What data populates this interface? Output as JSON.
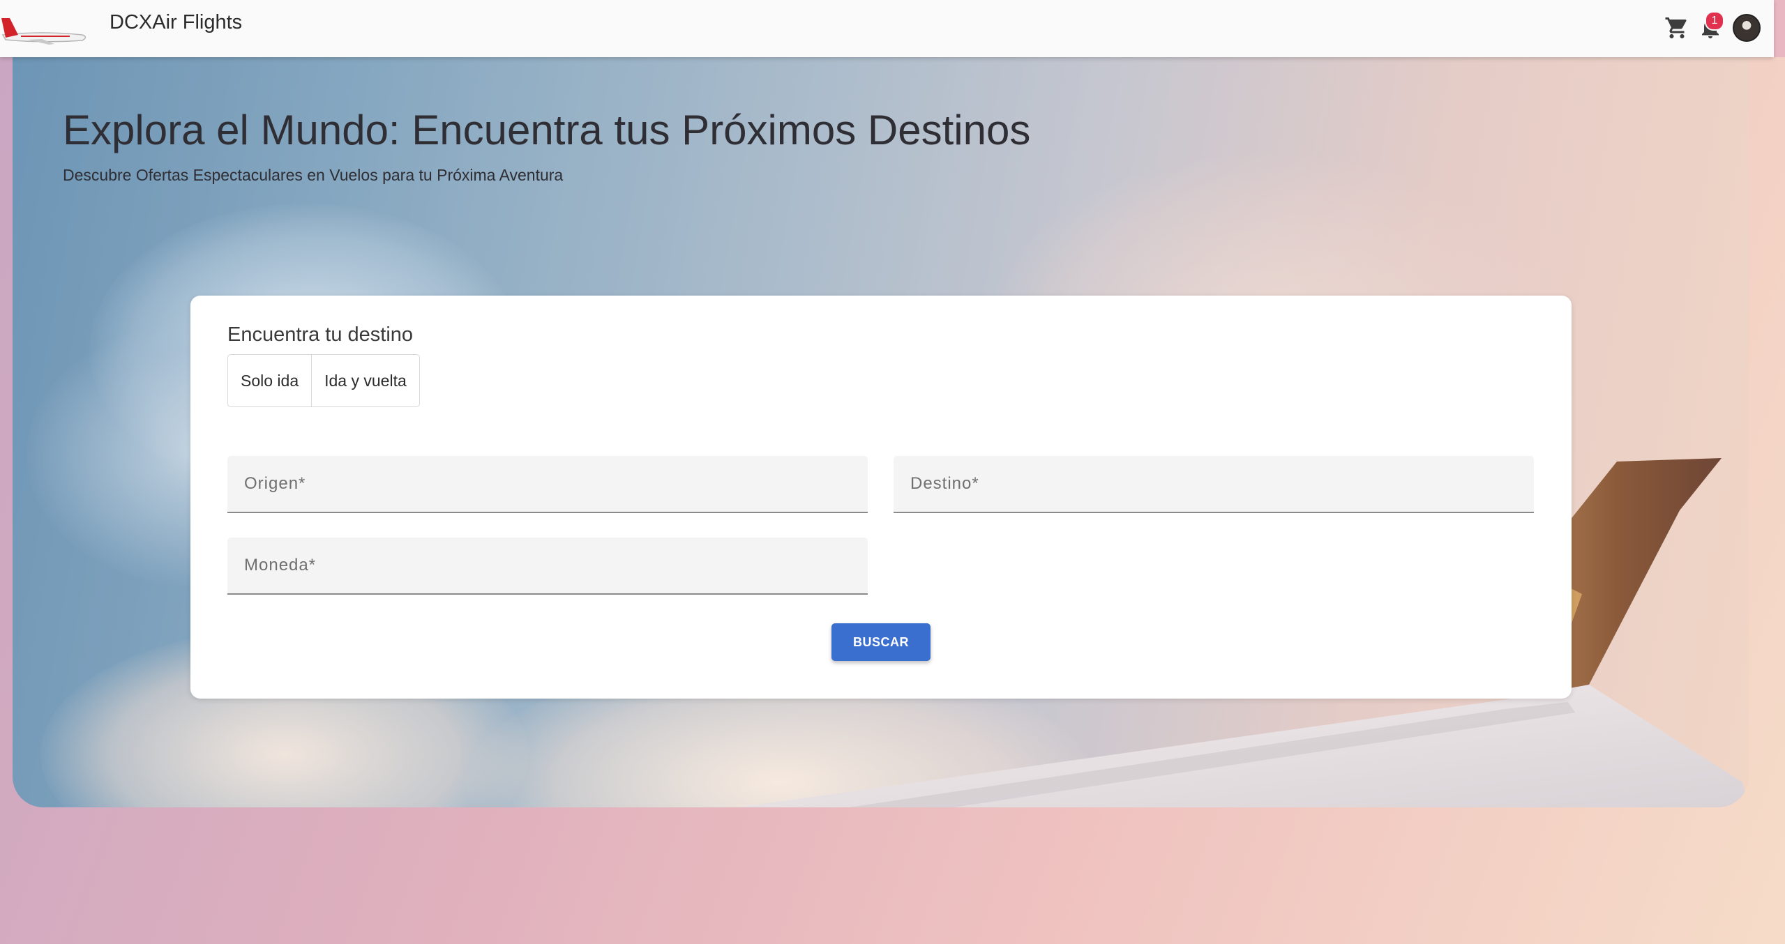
{
  "header": {
    "app_title": "DCXAir Flights",
    "icons": [
      "airplane-logo",
      "cart-icon",
      "bell-icon",
      "avatar"
    ],
    "notification_count": "1"
  },
  "hero": {
    "title": "Explora el Mundo: Encuentra tus Próximos Destinos",
    "subtitle": "Descubre Ofertas Espectaculares en Vuelos para tu Próxima Aventura"
  },
  "search_card": {
    "title": "Encuentra tu destino",
    "trip_types": [
      "Solo ida",
      "Ida y vuelta"
    ],
    "origin_placeholder": "Origen*",
    "destination_placeholder": "Destino*",
    "currency_placeholder": "Moneda*",
    "search_label": "BUSCAR"
  },
  "colors": {
    "accent": "#3a6fcf",
    "badge": "#e0324e",
    "logo_red": "#d2232a"
  }
}
